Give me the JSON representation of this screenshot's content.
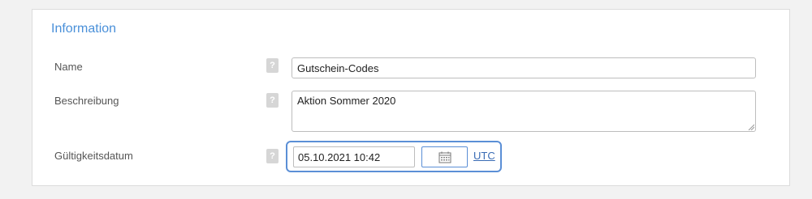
{
  "section": {
    "title": "Information"
  },
  "fields": {
    "name": {
      "label": "Name",
      "value": "Gutschein-Codes"
    },
    "description": {
      "label": "Beschreibung",
      "value": "Aktion Sommer 2020"
    },
    "validity": {
      "label": "Gültigkeitsdatum",
      "value": "05.10.2021 10:42",
      "timezone_link": "UTC"
    }
  },
  "help_glyph": "?",
  "icons": {
    "help": "question-mark-icon",
    "calendar": "calendar-icon"
  },
  "colors": {
    "accent": "#4a90d9",
    "focus_border": "#5b8fd6",
    "link": "#3a6cb5"
  }
}
